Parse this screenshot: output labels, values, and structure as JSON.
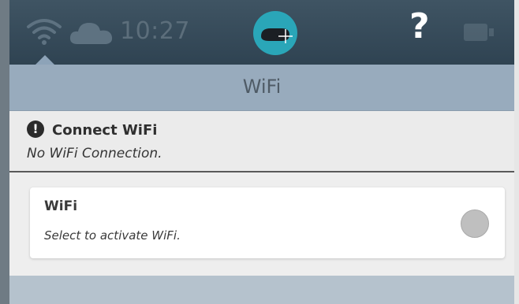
{
  "status_bar": {
    "time": "10:27",
    "help_symbol": "?",
    "icons": [
      "wifi-icon",
      "cloud-icon",
      "logo-icon",
      "help-icon",
      "faint-status-icon"
    ]
  },
  "header": {
    "title": "WiFi"
  },
  "notice": {
    "alert_symbol": "!",
    "title": "Connect WiFi",
    "message": "No WiFi Connection."
  },
  "wifi_card": {
    "title": "WiFi",
    "description": "Select to activate WiFi.",
    "toggle_state": "off"
  },
  "colors": {
    "status_bar": "#33475a",
    "title_bar": "#98abbd",
    "notice_bg": "#ebebeb",
    "card_bg": "#ffffff",
    "toggle_off": "#bfbfbf",
    "logo": "#2aa6b8"
  }
}
